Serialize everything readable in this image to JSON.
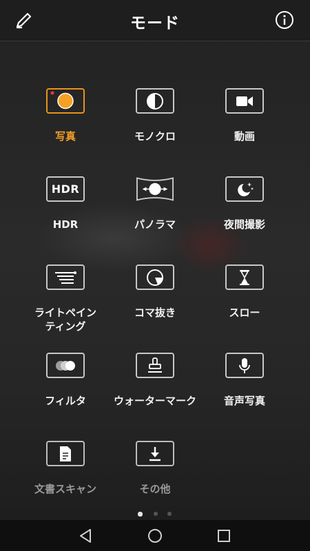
{
  "header": {
    "title": "モード"
  },
  "modes": [
    {
      "label": "写真",
      "icon": "camera-photo-icon",
      "active": true
    },
    {
      "label": "モノクロ",
      "icon": "monochrome-icon"
    },
    {
      "label": "動画",
      "icon": "video-icon"
    },
    {
      "label": "HDR",
      "icon": "hdr-icon",
      "icon_text": "HDR"
    },
    {
      "label": "パノラマ",
      "icon": "panorama-icon"
    },
    {
      "label": "夜間撮影",
      "icon": "night-mode-icon"
    },
    {
      "label": "ライトペイン\nティング",
      "icon": "light-painting-icon"
    },
    {
      "label": "コマ抜き",
      "icon": "time-lapse-icon"
    },
    {
      "label": "スロー",
      "icon": "slow-motion-icon"
    },
    {
      "label": "フィルタ",
      "icon": "filter-icon"
    },
    {
      "label": "ウォーターマーク",
      "icon": "watermark-icon"
    },
    {
      "label": "音声写真",
      "icon": "audio-note-icon"
    },
    {
      "label": "文書スキャン",
      "icon": "document-scan-icon",
      "dim": true
    },
    {
      "label": "その他",
      "icon": "download-more-icon",
      "dim": true
    }
  ],
  "pager": {
    "pages": 3,
    "current": 1
  },
  "colors": {
    "accent": "#f5a023",
    "background": "#1a1a1a",
    "record_dot": "#e53935"
  }
}
